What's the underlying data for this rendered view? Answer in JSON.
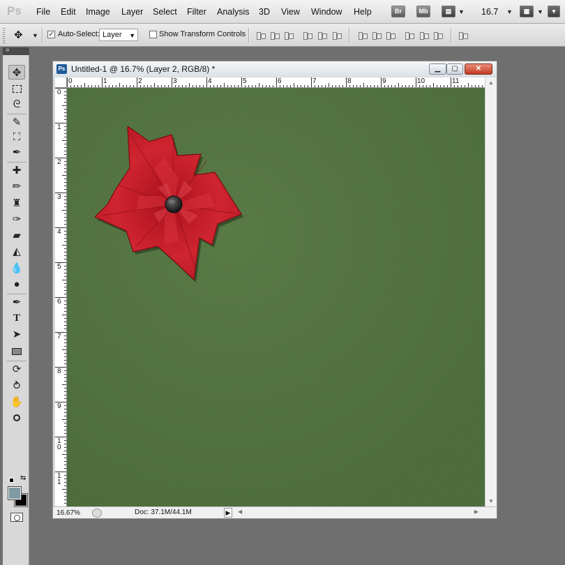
{
  "app": {
    "logo": "Ps"
  },
  "menu": {
    "items": [
      "File",
      "Edit",
      "Image",
      "Layer",
      "Select",
      "Filter",
      "Analysis",
      "3D",
      "View",
      "Window",
      "Help"
    ],
    "bridge_label": "Br",
    "minibridge_label": "Mb",
    "zoom_value": "16.7"
  },
  "options": {
    "auto_select_label": "Auto-Select:",
    "auto_select_checked": true,
    "auto_select_target": "Layer",
    "show_transform_label": "Show Transform Controls",
    "show_transform_checked": false
  },
  "tools": [
    {
      "name": "move-tool",
      "glyph": "✥",
      "active": true
    },
    {
      "name": "marquee-tool",
      "glyph": "⬚"
    },
    {
      "name": "lasso-tool",
      "glyph": "ᘓ"
    },
    {
      "name": "quick-selection-tool",
      "glyph": "✎"
    },
    {
      "name": "crop-tool",
      "glyph": "⛶"
    },
    {
      "name": "eyedropper-tool",
      "glyph": "✒"
    },
    {
      "name": "spot-healing-tool",
      "glyph": "✚"
    },
    {
      "name": "brush-tool",
      "glyph": "✏"
    },
    {
      "name": "clone-stamp-tool",
      "glyph": "♜"
    },
    {
      "name": "history-brush-tool",
      "glyph": "✑"
    },
    {
      "name": "eraser-tool",
      "glyph": "▰"
    },
    {
      "name": "paint-bucket-tool",
      "glyph": "◭"
    },
    {
      "name": "blur-tool",
      "glyph": "●"
    },
    {
      "name": "dodge-tool",
      "glyph": "◉"
    },
    {
      "name": "pen-tool",
      "glyph": "✒"
    },
    {
      "name": "type-tool",
      "glyph": "T"
    },
    {
      "name": "path-selection-tool",
      "glyph": "➤"
    },
    {
      "name": "rectangle-tool",
      "glyph": "▭"
    },
    {
      "name": "3d-rotate-tool",
      "glyph": "⟳"
    },
    {
      "name": "3d-orbit-tool",
      "glyph": "⥁"
    },
    {
      "name": "hand-tool",
      "glyph": "✋"
    },
    {
      "name": "zoom-tool",
      "glyph": "🔍"
    }
  ],
  "colors": {
    "foreground": "#7f9ba3",
    "background": "#000000",
    "canvas_green": "#547443",
    "flower_red": "#c8202a"
  },
  "document": {
    "title": "Untitled-1 @ 16.7% (Layer 2, RGB/8) *",
    "icon_label": "Ps",
    "ruler_h": [
      "0",
      "1",
      "2",
      "3",
      "4",
      "5",
      "6",
      "7",
      "8",
      "9",
      "10",
      "11"
    ],
    "ruler_v": [
      "0",
      "1",
      "2",
      "3",
      "4",
      "5",
      "6",
      "7",
      "8",
      "9",
      "10",
      "11"
    ],
    "zoom": "16.67%",
    "doc_size": "Doc: 37.1M/44.1M"
  }
}
